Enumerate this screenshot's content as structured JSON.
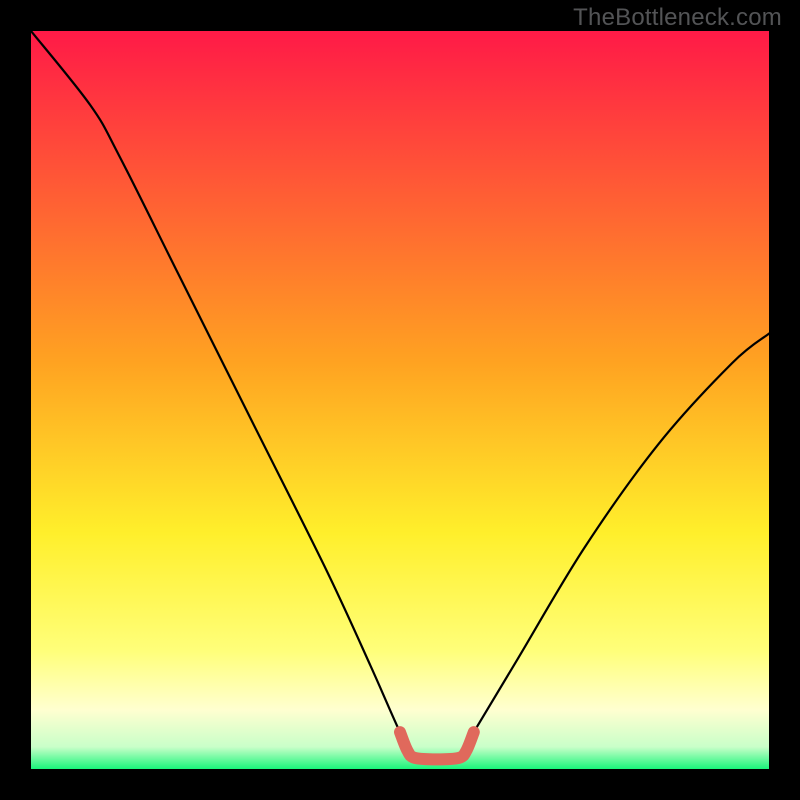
{
  "watermark": "TheBottleneck.com",
  "chart_data": {
    "type": "line",
    "title": "",
    "xlabel": "",
    "ylabel": "",
    "xlim": [
      0,
      100
    ],
    "ylim": [
      0,
      100
    ],
    "gradient_stops": [
      {
        "offset": 0,
        "color": "#ff1a47"
      },
      {
        "offset": 0.45,
        "color": "#ffa321"
      },
      {
        "offset": 0.68,
        "color": "#ffef2b"
      },
      {
        "offset": 0.84,
        "color": "#ffff7a"
      },
      {
        "offset": 0.92,
        "color": "#ffffd0"
      },
      {
        "offset": 0.97,
        "color": "#c9ffc9"
      },
      {
        "offset": 1.0,
        "color": "#19f57a"
      }
    ],
    "curve": [
      {
        "x": 0,
        "y": 100
      },
      {
        "x": 8,
        "y": 90
      },
      {
        "x": 12,
        "y": 83
      },
      {
        "x": 20,
        "y": 67
      },
      {
        "x": 30,
        "y": 47
      },
      {
        "x": 40,
        "y": 27
      },
      {
        "x": 46,
        "y": 14
      },
      {
        "x": 50,
        "y": 5
      },
      {
        "x": 52,
        "y": 1.5
      },
      {
        "x": 58,
        "y": 1.5
      },
      {
        "x": 60,
        "y": 5
      },
      {
        "x": 66,
        "y": 15
      },
      {
        "x": 75,
        "y": 30
      },
      {
        "x": 85,
        "y": 44
      },
      {
        "x": 95,
        "y": 55
      },
      {
        "x": 100,
        "y": 59
      }
    ],
    "highlight_segment": {
      "color": "#e0695c",
      "points": [
        {
          "x": 50.0,
          "y": 5.0
        },
        {
          "x": 51.0,
          "y": 2.5
        },
        {
          "x": 52.0,
          "y": 1.5
        },
        {
          "x": 55.0,
          "y": 1.3
        },
        {
          "x": 58.0,
          "y": 1.5
        },
        {
          "x": 59.0,
          "y": 2.5
        },
        {
          "x": 60.0,
          "y": 5.0
        }
      ]
    }
  }
}
